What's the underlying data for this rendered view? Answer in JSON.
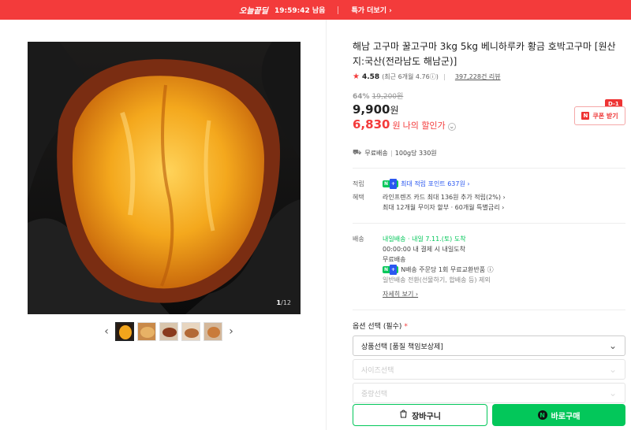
{
  "promo": {
    "badge": "오늘끝딜",
    "timer": "19:59:42 남음",
    "more": "특가 더보기 ›"
  },
  "gallery": {
    "current": "1",
    "total": "/12",
    "thumb_count": 5
  },
  "product": {
    "title": "해남 고구마 꿀고구마 3kg 5kg 베니하루카 황금 호박고구마 [원산지:국산(전라남도 해남군)]",
    "rating": "4.58",
    "rating_note": "(최근 6개월 4.76ⓘ)",
    "review_count": "397,228건 리뷰",
    "discount_rate": "64%",
    "original_price": "19,200원",
    "price": "9,900",
    "price_unit": "원",
    "my_price": "6,830",
    "my_price_unit": "원",
    "my_price_label": "나의 할인가",
    "coupon": {
      "label": "쿠폰 받기",
      "dday": "D-1"
    },
    "shipping_summary": {
      "free": "무료배송",
      "unit_price": "100g당 330원"
    }
  },
  "benefits": {
    "points_label": "적립",
    "points_text": "최대 적립 포인트 637원 ›",
    "benefit_label": "혜택",
    "benefit_line1": "라인프렌즈 카드 최대 136원 추가 적립(2%) ›",
    "benefit_line2": "최대 12개월 무이자 할부 · 60개월 특별금리 ›"
  },
  "delivery": {
    "label": "배송",
    "tag": "내일배송",
    "eta": "· 내일 7.11.(토) 도착",
    "line1": "00:00:00  내 결제 시 내일도착",
    "line2": "무료배송",
    "line3": "N배송 주문당 1회 무료교환반품 ⓘ",
    "line4": "일반배송 전환(선물하기, 합배송 등) 제외",
    "more": "자세히 보기 ›"
  },
  "options": {
    "title": "옵션 선택 (필수)",
    "required_mark": "*",
    "select1": "상품선택 [품질 책임보상제]",
    "select2": "사이즈선택",
    "select3": "중량선택"
  },
  "actions": {
    "cart": "장바구니",
    "buy": "바로구매"
  },
  "colors": {
    "brand_red": "#f33b3b",
    "naver_green": "#03c75a",
    "link_blue": "#2b58f0"
  }
}
